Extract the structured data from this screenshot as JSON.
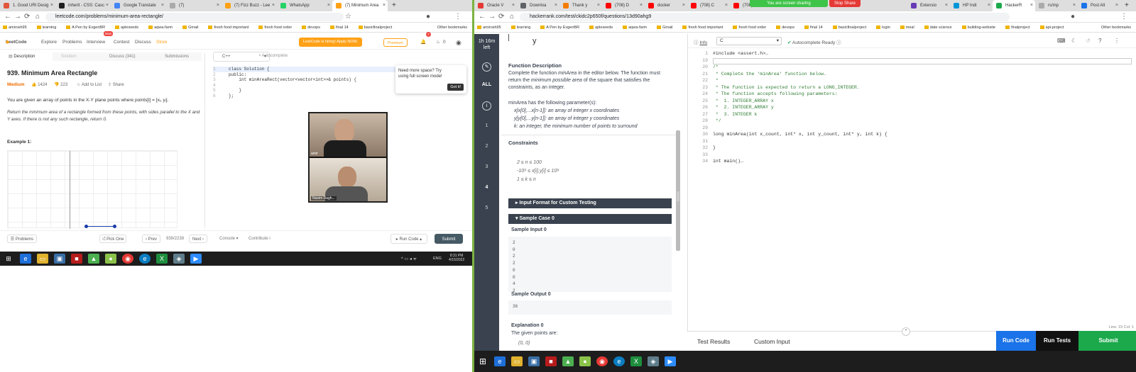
{
  "left_browser": {
    "tabs": [
      {
        "label": "1. Good URI Desig",
        "color": "#e2563b"
      },
      {
        "label": "inherit - CSS: Casc",
        "color": "#1f1f1f"
      },
      {
        "label": "Google Translate",
        "color": "#4285f4"
      },
      {
        "label": "(7)",
        "color": "#aaa"
      },
      {
        "label": "(7) Fizz Buzz - Lee",
        "color": "#ffa116"
      },
      {
        "label": "WhatsApp",
        "color": "#25d366"
      },
      {
        "label": "(7) Minimum Area",
        "color": "#ffa116"
      }
    ],
    "url": "leetcode.com/problems/minimum-area-rectangle/",
    "bookmarks": [
      "amirosh95",
      "learning",
      "A Pen by EvgenBR",
      "apleseeds",
      "aqwa-farm",
      "Gmail",
      "fresh food important",
      "fresh food order",
      "devops",
      "final 14",
      "basicfinalproject"
    ],
    "other_bookmarks": "Other bookmarks"
  },
  "leetcode": {
    "logo": "LeetCode",
    "nav": [
      "Explore",
      "Problems",
      "Interview",
      "Contest",
      "Discuss",
      "Store"
    ],
    "new_badge": "New",
    "promo": "LeetCode is hiring! Apply NOW.",
    "premium": "Premium",
    "notif_count": "7",
    "coins": "0",
    "tabs": [
      "Description",
      "Solution",
      "Discuss (341)",
      "Submissions"
    ],
    "title": "939. Minimum Area Rectangle",
    "difficulty": "Medium",
    "likes": "1424",
    "dislikes": "223",
    "add_list": "Add to List",
    "share": "Share",
    "desc1": "You are given an array of points in the X-Y plane points where points[i] = [xᵢ, yᵢ].",
    "desc2": "Return the minimum area of a rectangle formed from these points, with sides parallel to the X and Y axes. If there is not any such rectangle, return 0.",
    "example": "Example 1:",
    "lang": "C++",
    "autocomplete": "Autocomplete",
    "code": [
      "class Solution {",
      "public:",
      "    int minAreaRect(vector<vector<int>>& points) {",
      "",
      "    }",
      "};"
    ],
    "tooltip": "Need more space? Try using full screen mode!",
    "tooltip_btn": "Got it!",
    "video_top": "amir",
    "video_bottom": "Nasim Dagh...",
    "bottom": {
      "problems": "Problems",
      "pick": "Pick One",
      "prev": "Prev",
      "page": "939/2238",
      "next": "Next",
      "console": "Console",
      "contribute": "Contribute",
      "run": "Run Code",
      "submit": "Submit"
    },
    "tray_lang": "ENG",
    "time": "8:31 PM",
    "date": "4/15/2022"
  },
  "right_browser": {
    "tabs": [
      {
        "label": "Oracle V",
        "color": "#e53935"
      },
      {
        "label": "Downloa",
        "color": "#5f6368"
      },
      {
        "label": "Thank y",
        "color": "#f57c00"
      },
      {
        "label": "(708) D",
        "color": "#ff0000"
      },
      {
        "label": "docker",
        "color": "#ff0000"
      },
      {
        "label": "(708) C",
        "color": "#ff0000"
      },
      {
        "label": "(708) bu",
        "color": "#ff0000"
      }
    ],
    "tabs_after": [
      {
        "label": "Extensio",
        "color": "#673ab7"
      },
      {
        "label": "HP Indi",
        "color": "#0096d6"
      },
      {
        "label": "HackerR",
        "color": "#1ba94c"
      },
      {
        "label": "rs/mp",
        "color": "#aaa"
      },
      {
        "label": "Post Alt",
        "color": "#1a73e8"
      }
    ],
    "sharing": "You are screen sharing",
    "stop_share": "Stop Share",
    "url": "hackerrank.com/test/ckidc2p650f/questions/13d90ahg9",
    "bookmarks": [
      "amirosh95",
      "learning",
      "A Pen by EvgenBR",
      "apleseeds",
      "aqwa-farm",
      "Gmail",
      "fresh food important",
      "fresh food order",
      "devops",
      "final 14",
      "basicfinalproject",
      "login",
      "meal",
      "date science",
      "building-website",
      "finalproject",
      "api-project"
    ],
    "other_bookmarks": "Other bookmarks"
  },
  "hackerrank": {
    "timer1": "1h 16m",
    "timer2": "left",
    "side_all": "ALL",
    "side_numbers": [
      "1",
      "2",
      "3",
      "4",
      "5"
    ],
    "plot_label": "y",
    "fd_title": "Function Description",
    "fd_text_pre": "Complete the function ",
    "fd_func": "minArea",
    "fd_text_mid": " in the editor below. The function must return the ",
    "fd_em": "minimum possible area",
    "fd_text_post": " of the square that satisfies the constraints, as an integer.",
    "params_title": "minArea has the following parameter(s):",
    "params": [
      "x[x[0],...x[n-1]]:  an array of integer x coordinates",
      "y[y[0],...y[n-1]]:  an array of integer y coordinates",
      "k:  an integer, the minimum number of points to surround"
    ],
    "constraints_title": "Constraints",
    "constraints": [
      "2 ≤ n ≤ 100",
      "-10⁹ ≤ x[i],y[i] ≤ 10⁹",
      "1 ≤ k ≤ n"
    ],
    "input_format": "Input Format for Custom Testing",
    "sample_case": "Sample Case 0",
    "sample_input_title": "Sample Input 0",
    "sample_input": [
      "2",
      "0",
      "2",
      "2",
      "0",
      "0",
      "4",
      "2"
    ],
    "sample_output_title": "Sample Output 0",
    "sample_output": "36",
    "explanation_title": "Explanation 0",
    "explanation": "The given points are:",
    "first_point": "(0, 0)",
    "info": "Info",
    "lang": "C",
    "autocomplete": "Autocomplete Ready",
    "code_lines": [
      {
        "n": "1",
        "t": "#include <assert.h>…"
      },
      {
        "n": "19",
        "t": ""
      },
      {
        "n": "20",
        "t": "/*"
      },
      {
        "n": "21",
        "t": " * Complete the 'minArea' function below."
      },
      {
        "n": "22",
        "t": " *"
      },
      {
        "n": "23",
        "t": " * The function is expected to return a LONG_INTEGER."
      },
      {
        "n": "24",
        "t": " * The function accepts following parameters:"
      },
      {
        "n": "25",
        "t": " *  1. INTEGER_ARRAY x"
      },
      {
        "n": "26",
        "t": " *  2. INTEGER_ARRAY y"
      },
      {
        "n": "27",
        "t": " *  3. INTEGER k"
      },
      {
        "n": "28",
        "t": " */"
      },
      {
        "n": "29",
        "t": ""
      },
      {
        "n": "30",
        "t": "long minArea(int x_count, int* x, int y_count, int* y, int k) {"
      },
      {
        "n": "31",
        "t": ""
      },
      {
        "n": "32",
        "t": "}"
      },
      {
        "n": "33",
        "t": ""
      },
      {
        "n": "34",
        "t": "int main()…"
      }
    ],
    "cursor_pos": "Line: 19 Col: 1",
    "test_results": "Test Results",
    "custom_input": "Custom Input",
    "run_code": "Run Code",
    "run_tests": "Run Tests",
    "submit": "Submit"
  }
}
